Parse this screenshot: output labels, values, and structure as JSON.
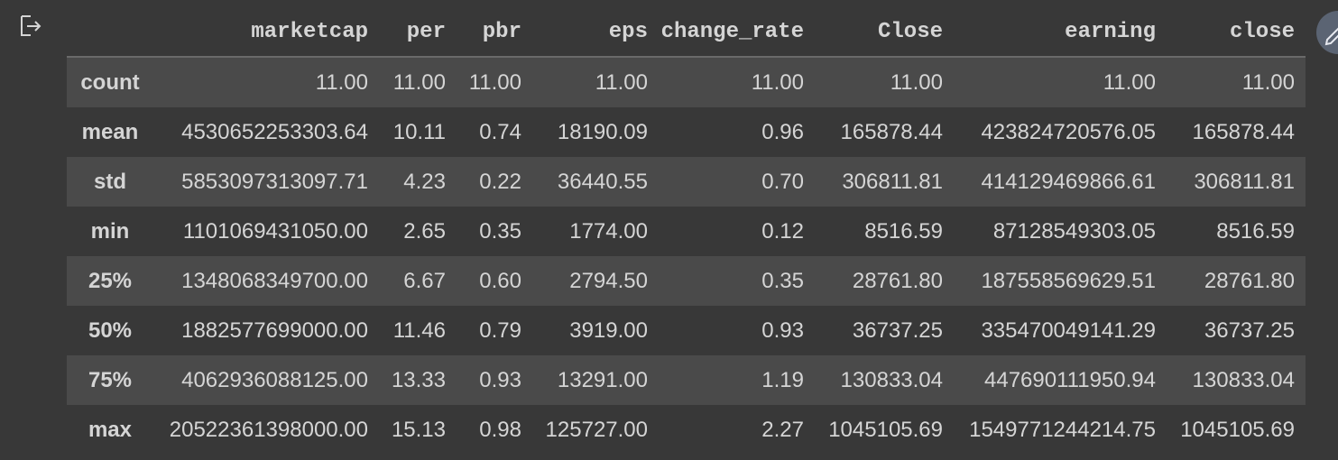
{
  "output_area": {
    "output_icon": "output-arrow-icon",
    "side_button_icon": "pencil-icon"
  },
  "table": {
    "columns": [
      "marketcap",
      "per",
      "pbr",
      "eps",
      "change_rate",
      "Close",
      "earning",
      "close"
    ],
    "rows": [
      {
        "label": "count",
        "values": [
          "11.00",
          "11.00",
          "11.00",
          "11.00",
          "11.00",
          "11.00",
          "11.00",
          "11.00"
        ]
      },
      {
        "label": "mean",
        "values": [
          "4530652253303.64",
          "10.11",
          "0.74",
          "18190.09",
          "0.96",
          "165878.44",
          "423824720576.05",
          "165878.44"
        ]
      },
      {
        "label": "std",
        "values": [
          "5853097313097.71",
          "4.23",
          "0.22",
          "36440.55",
          "0.70",
          "306811.81",
          "414129469866.61",
          "306811.81"
        ]
      },
      {
        "label": "min",
        "values": [
          "1101069431050.00",
          "2.65",
          "0.35",
          "1774.00",
          "0.12",
          "8516.59",
          "87128549303.05",
          "8516.59"
        ]
      },
      {
        "label": "25%",
        "values": [
          "1348068349700.00",
          "6.67",
          "0.60",
          "2794.50",
          "0.35",
          "28761.80",
          "187558569629.51",
          "28761.80"
        ]
      },
      {
        "label": "50%",
        "values": [
          "1882577699000.00",
          "11.46",
          "0.79",
          "3919.00",
          "0.93",
          "36737.25",
          "335470049141.29",
          "36737.25"
        ]
      },
      {
        "label": "75%",
        "values": [
          "4062936088125.00",
          "13.33",
          "0.93",
          "13291.00",
          "1.19",
          "130833.04",
          "447690111950.94",
          "130833.04"
        ]
      },
      {
        "label": "max",
        "values": [
          "20522361398000.00",
          "15.13",
          "0.98",
          "125727.00",
          "2.27",
          "1045105.69",
          "1549771244214.75",
          "1045105.69"
        ]
      }
    ]
  }
}
